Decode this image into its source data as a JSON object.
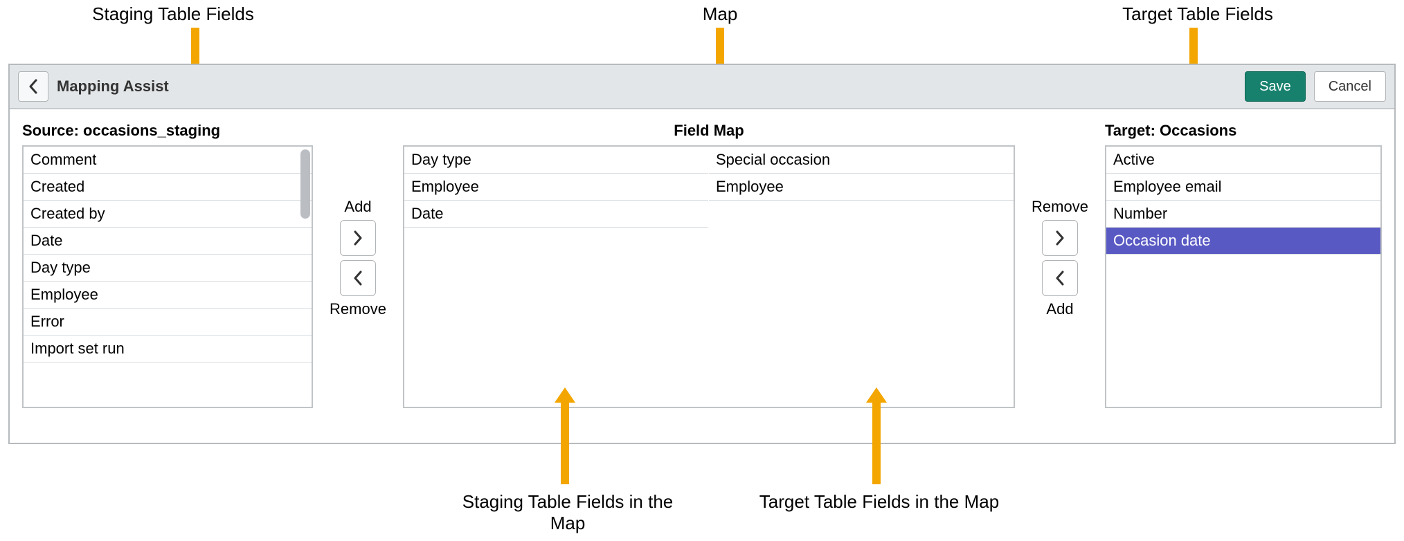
{
  "annotations": {
    "staging_fields": "Staging Table Fields",
    "map": "Map",
    "target_fields": "Target Table Fields",
    "staging_in_map": "Staging Table Fields in the Map",
    "target_in_map": "Target Table Fields in the Map"
  },
  "header": {
    "title": "Mapping Assist",
    "save_label": "Save",
    "cancel_label": "Cancel"
  },
  "source": {
    "label": "Source: occasions_staging",
    "items": [
      "Comment",
      "Created",
      "Created by",
      "Date",
      "Day type",
      "Employee",
      "Error",
      "Import set run"
    ]
  },
  "left_buttons": {
    "add": "Add",
    "remove": "Remove"
  },
  "fieldmap": {
    "label": "Field Map",
    "left": [
      "Day type",
      "Employee",
      "Date"
    ],
    "right": [
      "Special occasion",
      "Employee"
    ]
  },
  "right_buttons": {
    "remove": "Remove",
    "add": "Add"
  },
  "target": {
    "label": "Target: Occasions",
    "items": [
      "Active",
      "Employee email",
      "Number",
      "Occasion date"
    ],
    "selected_index": 3
  }
}
